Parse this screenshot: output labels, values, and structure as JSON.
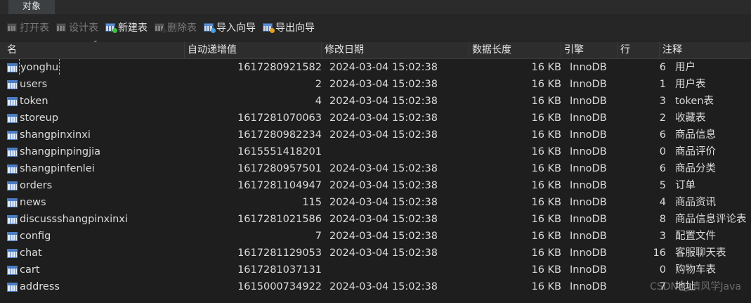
{
  "tab": {
    "label": "对象"
  },
  "toolbar": {
    "open": "打开表",
    "design": "设计表",
    "new": "新建表",
    "delete": "删除表",
    "import": "导入向导",
    "export": "导出向导"
  },
  "columns": [
    "名",
    "自动递增值",
    "修改日期",
    "数据长度",
    "引擎",
    "行",
    "注释"
  ],
  "rows": [
    {
      "name": "yonghu",
      "auto": "1617280921582",
      "date": "2024-03-04 15:02:38",
      "len": "16 KB",
      "engine": "InnoDB",
      "rows": "6",
      "comment": "用户"
    },
    {
      "name": "users",
      "auto": "2",
      "date": "2024-03-04 15:02:38",
      "len": "16 KB",
      "engine": "InnoDB",
      "rows": "1",
      "comment": "用户表"
    },
    {
      "name": "token",
      "auto": "4",
      "date": "2024-03-04 15:02:38",
      "len": "16 KB",
      "engine": "InnoDB",
      "rows": "3",
      "comment": "token表"
    },
    {
      "name": "storeup",
      "auto": "1617281070063",
      "date": "2024-03-04 15:02:38",
      "len": "16 KB",
      "engine": "InnoDB",
      "rows": "2",
      "comment": "收藏表"
    },
    {
      "name": "shangpinxinxi",
      "auto": "1617280982234",
      "date": "2024-03-04 15:02:38",
      "len": "16 KB",
      "engine": "InnoDB",
      "rows": "6",
      "comment": "商品信息"
    },
    {
      "name": "shangpinpingjia",
      "auto": "1615551418201",
      "date": "",
      "len": "16 KB",
      "engine": "InnoDB",
      "rows": "0",
      "comment": "商品评价"
    },
    {
      "name": "shangpinfenlei",
      "auto": "1617280957501",
      "date": "2024-03-04 15:02:38",
      "len": "16 KB",
      "engine": "InnoDB",
      "rows": "6",
      "comment": "商品分类"
    },
    {
      "name": "orders",
      "auto": "1617281104947",
      "date": "2024-03-04 15:02:38",
      "len": "16 KB",
      "engine": "InnoDB",
      "rows": "5",
      "comment": "订单"
    },
    {
      "name": "news",
      "auto": "115",
      "date": "2024-03-04 15:02:38",
      "len": "16 KB",
      "engine": "InnoDB",
      "rows": "4",
      "comment": "商品资讯"
    },
    {
      "name": "discussshangpinxinxi",
      "auto": "1617281021586",
      "date": "2024-03-04 15:02:38",
      "len": "16 KB",
      "engine": "InnoDB",
      "rows": "8",
      "comment": "商品信息评论表"
    },
    {
      "name": "config",
      "auto": "7",
      "date": "2024-03-04 15:02:38",
      "len": "16 KB",
      "engine": "InnoDB",
      "rows": "3",
      "comment": "配置文件"
    },
    {
      "name": "chat",
      "auto": "1617281129053",
      "date": "2024-03-04 15:02:38",
      "len": "16 KB",
      "engine": "InnoDB",
      "rows": "16",
      "comment": "客服聊天表"
    },
    {
      "name": "cart",
      "auto": "1617281037131",
      "date": "",
      "len": "16 KB",
      "engine": "InnoDB",
      "rows": "0",
      "comment": "购物车表"
    },
    {
      "name": "address",
      "auto": "1615000734922",
      "date": "2024-03-04 15:02:38",
      "len": "16 KB",
      "engine": "InnoDB",
      "rows": "7",
      "comment": "地址"
    }
  ],
  "watermark": "CSDN @清风学Java"
}
